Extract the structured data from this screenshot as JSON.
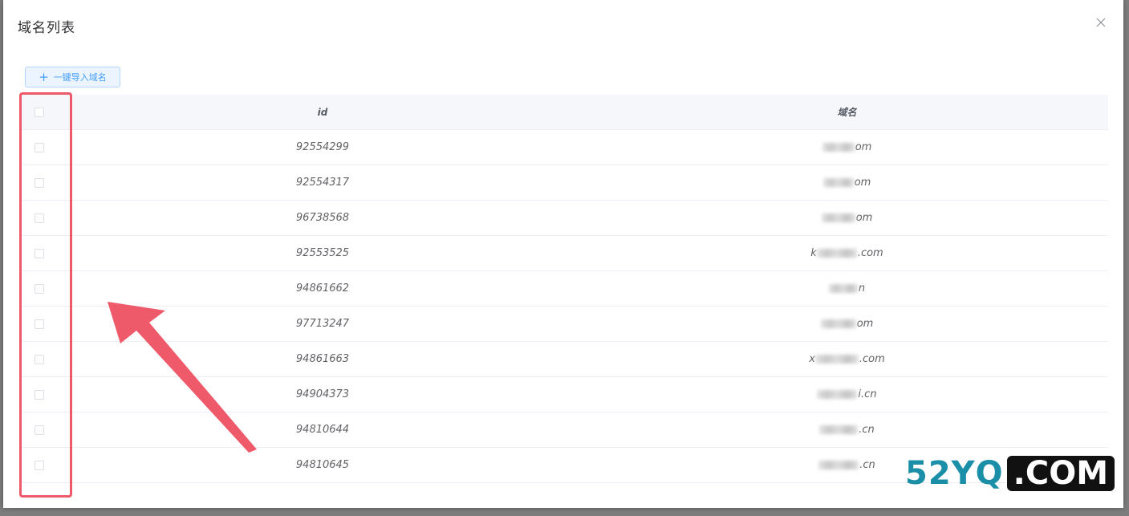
{
  "dialog": {
    "title": "域名列表",
    "import_button_label": "一键导入域名"
  },
  "table": {
    "columns": {
      "id": "id",
      "domain": "域名"
    },
    "rows": [
      {
        "id": "92554299",
        "domain_suffix": "om"
      },
      {
        "id": "92554317",
        "domain_suffix": "om"
      },
      {
        "id": "96738568",
        "domain_suffix": "om"
      },
      {
        "id": "92553525",
        "domain_prefix": "k",
        "domain_suffix": ".com"
      },
      {
        "id": "94861662",
        "domain_suffix": "n"
      },
      {
        "id": "97713247",
        "domain_suffix": "om"
      },
      {
        "id": "94861663",
        "domain_prefix": "x",
        "domain_suffix": ".com"
      },
      {
        "id": "94904373",
        "domain_suffix": "i.cn"
      },
      {
        "id": "94810644",
        "domain_suffix": ".cn"
      },
      {
        "id": "94810645",
        "domain_suffix": ".cn"
      }
    ]
  },
  "watermark": {
    "left": "52YQ",
    "right": ".COM"
  },
  "colors": {
    "annotation": "#ee5a6a",
    "primary": "#409eff",
    "watermark_teal": "#1b8fa8"
  }
}
